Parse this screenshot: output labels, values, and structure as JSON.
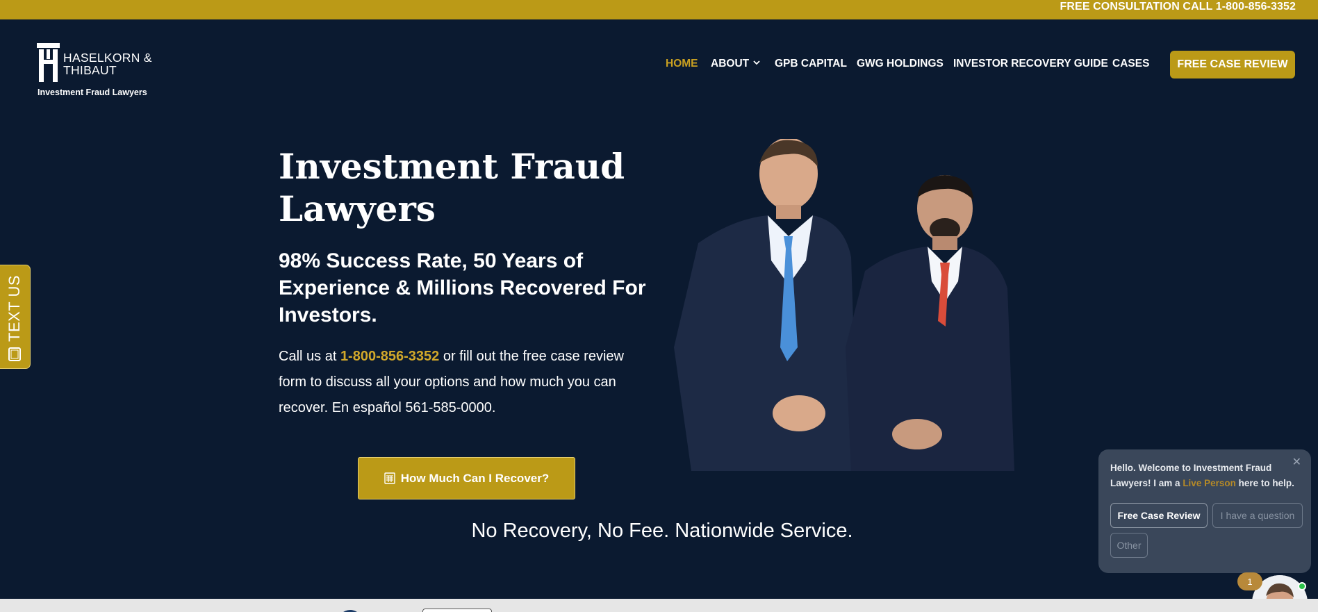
{
  "topbar": {
    "text": "FREE CONSULTATION CALL 1-800-856-3352"
  },
  "logo": {
    "name_line1": "HASELKORN &",
    "name_line2": "THIBAUT",
    "tagline": "Investment Fraud Lawyers",
    "icon": "ht-monogram-icon"
  },
  "nav": {
    "items": [
      {
        "label": "HOME",
        "active": true
      },
      {
        "label": "ABOUT",
        "has_dropdown": true
      },
      {
        "label": "GPB CAPITAL"
      },
      {
        "label": "GWG HOLDINGS"
      },
      {
        "label": "INVESTOR RECOVERY GUIDE"
      },
      {
        "label": "CASES"
      }
    ],
    "cta_label": "FREE CASE REVIEW"
  },
  "side_tab": {
    "label": "TEXT US",
    "icon": "mobile-phone-icon"
  },
  "hero": {
    "title_line1": "Investment Fraud",
    "title_line2": "Lawyers",
    "subtitle": "98% Success Rate, 50 Years of Experience & Millions Recovered For Investors.",
    "body_prefix": "Call us at ",
    "body_phone": "1-800-856-3352",
    "body_suffix": " or fill out the free case review form to discuss all your options and how much you can recover. En español 561-585-0000.",
    "button_label": "How Much Can I Recover?",
    "button_icon": "calculator-icon",
    "tagline": "No Recovery, No Fee. Nationwide Service."
  },
  "chat": {
    "message_prefix": "Hello. Welcome to Investment Fraud Lawyers! I am a ",
    "message_highlight": "Live Person",
    "message_suffix": " here to help.",
    "options": [
      "Free Case Review",
      "I have a question",
      "Other"
    ],
    "badge_count": "1"
  },
  "colors": {
    "background": "#0b1a30",
    "accent": "#bb9a17",
    "accent_text": "#c9a021"
  }
}
